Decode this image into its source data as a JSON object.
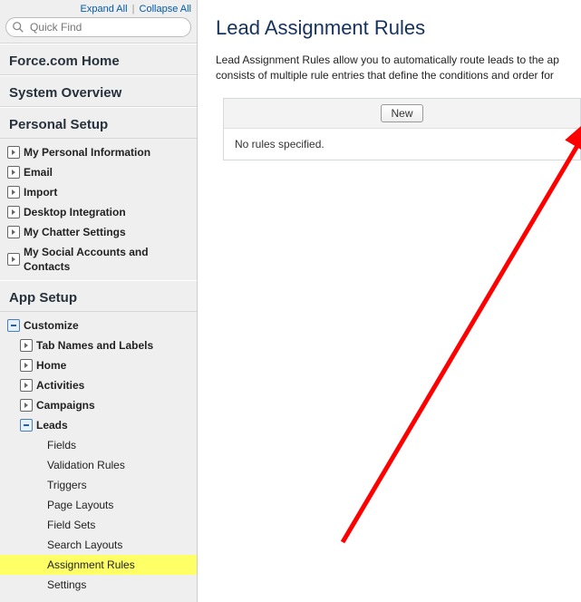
{
  "sidebar": {
    "expandAll": "Expand All",
    "collapseAll": "Collapse All",
    "quickFindPlaceholder": "Quick Find",
    "homeTitle": "Force.com Home",
    "systemOverviewTitle": "System Overview",
    "personalSetupTitle": "Personal Setup",
    "personalItems": [
      "My Personal Information",
      "Email",
      "Import",
      "Desktop Integration",
      "My Chatter Settings",
      "My Social Accounts and Contacts"
    ],
    "appSetupTitle": "App Setup",
    "customizeLabel": "Customize",
    "customizeChildren": [
      "Tab Names and Labels",
      "Home",
      "Activities",
      "Campaigns"
    ],
    "leadsLabel": "Leads",
    "leadsChildren": [
      "Fields",
      "Validation Rules",
      "Triggers",
      "Page Layouts",
      "Field Sets",
      "Search Layouts",
      "Assignment Rules",
      "Settings"
    ],
    "leadsSelectedIndex": 6
  },
  "main": {
    "heading": "Lead Assignment Rules",
    "descLine1": "Lead Assignment Rules allow you to automatically route leads to the ap",
    "descLine2": "consists of multiple rule entries that define the conditions and order for ",
    "newButton": "New",
    "emptyMessage": "No rules specified."
  }
}
